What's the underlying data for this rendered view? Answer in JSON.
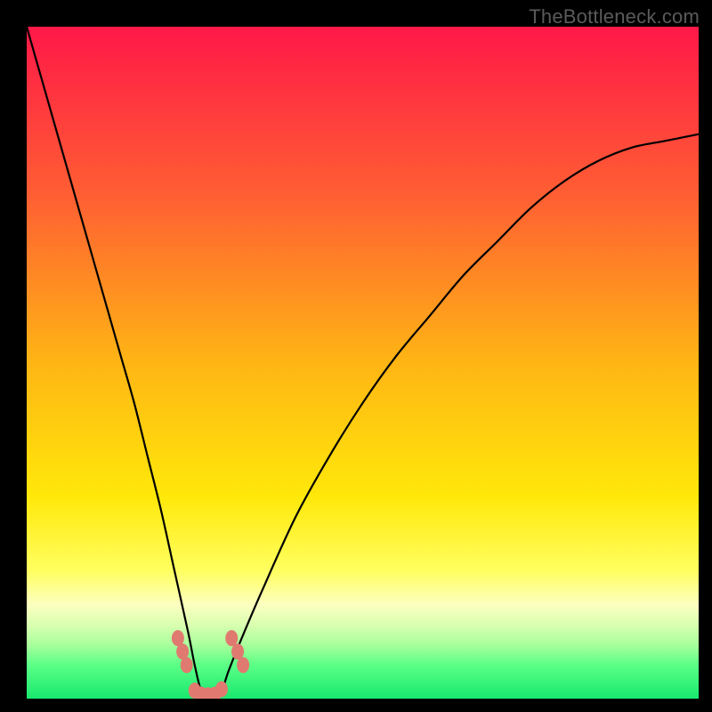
{
  "watermark": "TheBottleneck.com",
  "chart_data": {
    "type": "line",
    "title": "",
    "xlabel": "",
    "ylabel": "",
    "xlim": [
      0,
      100
    ],
    "ylim": [
      0,
      100
    ],
    "grid": false,
    "legend": false,
    "background_gradient": {
      "stops": [
        {
          "offset": 0,
          "color": "#ff1848"
        },
        {
          "offset": 25,
          "color": "#ff5e33"
        },
        {
          "offset": 50,
          "color": "#ffb514"
        },
        {
          "offset": 70,
          "color": "#ffe80a"
        },
        {
          "offset": 81,
          "color": "#ffff60"
        },
        {
          "offset": 86,
          "color": "#fcffbf"
        },
        {
          "offset": 89,
          "color": "#d9ffb0"
        },
        {
          "offset": 92,
          "color": "#a8ff9c"
        },
        {
          "offset": 95,
          "color": "#5bff86"
        },
        {
          "offset": 100,
          "color": "#18e86f"
        }
      ]
    },
    "series": [
      {
        "name": "bottleneck-curve",
        "color": "#000000",
        "x": [
          0,
          2,
          4,
          6,
          8,
          10,
          12,
          14,
          16,
          18,
          20,
          22,
          24,
          25,
          26,
          27,
          28,
          29,
          30,
          32,
          35,
          40,
          45,
          50,
          55,
          60,
          65,
          70,
          75,
          80,
          85,
          90,
          95,
          100
        ],
        "y": [
          100,
          93,
          86,
          79,
          72,
          65,
          58,
          51,
          44,
          36,
          28,
          19,
          10,
          5,
          1,
          0,
          0,
          1,
          4,
          9,
          16,
          27,
          36,
          44,
          51,
          57,
          63,
          68,
          73,
          77,
          80,
          82,
          83,
          84
        ]
      }
    ],
    "markers": [
      {
        "name": "left-cluster",
        "color": "#e07a70",
        "points": [
          [
            22.5,
            9
          ],
          [
            23.2,
            7
          ],
          [
            23.8,
            5
          ]
        ]
      },
      {
        "name": "right-cluster",
        "color": "#e07a70",
        "points": [
          [
            30.5,
            9
          ],
          [
            31.4,
            7
          ],
          [
            32.2,
            5
          ]
        ]
      },
      {
        "name": "bottom-run",
        "color": "#e07a70",
        "points": [
          [
            25.0,
            1.2
          ],
          [
            26.0,
            0.6
          ],
          [
            27.0,
            0.5
          ],
          [
            28.0,
            0.6
          ],
          [
            29.0,
            1.4
          ]
        ]
      }
    ]
  }
}
